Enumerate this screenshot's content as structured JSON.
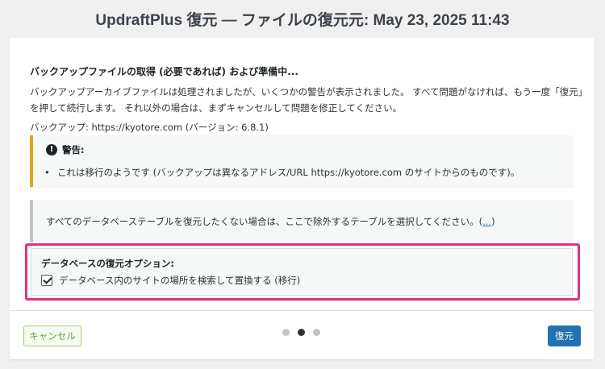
{
  "window": {
    "title": "UpdraftPlus 復元 — ファイルの復元元: May 23, 2025 11:43"
  },
  "main": {
    "heading": "バックアップファイルの取得 (必要であれば) および準備中...",
    "paragraph": "バックアップアーカイブファイルは処理されましたが、いくつかの警告が表示されました。 すべて問題がなければ、もう一度「復元」を押して続行します。 それ以外の場合は、まずキャンセルして問題を修正してください。",
    "backup_info": "バックアップ: https://kyotore.com (バージョン: 6.8.1)"
  },
  "warning": {
    "icon": "exclamation-icon",
    "title": "警告:",
    "items": [
      "これは移行のようです (バックアップは異なるアドレス/URL https://kyotore.com のサイトからのものです)。"
    ],
    "accent_color": "#dba617"
  },
  "tables": {
    "text": "すべてのデータベーステーブルを復元したくない場合は、ここで除外するテーブルを選択してください。",
    "link_open": "(",
    "link": "...",
    "link_close": ")"
  },
  "db_options": {
    "title": "データベースの復元オプション:",
    "search_replace_label": "データベース内のサイトの場所を検索して置換する (移行)",
    "search_replace_checked": true,
    "highlight_color": "#e3307a"
  },
  "footer": {
    "cancel_label": "キャンセル",
    "restore_label": "復元",
    "steps_total": 3,
    "current_step": 2,
    "primary_color": "#2271b1"
  }
}
